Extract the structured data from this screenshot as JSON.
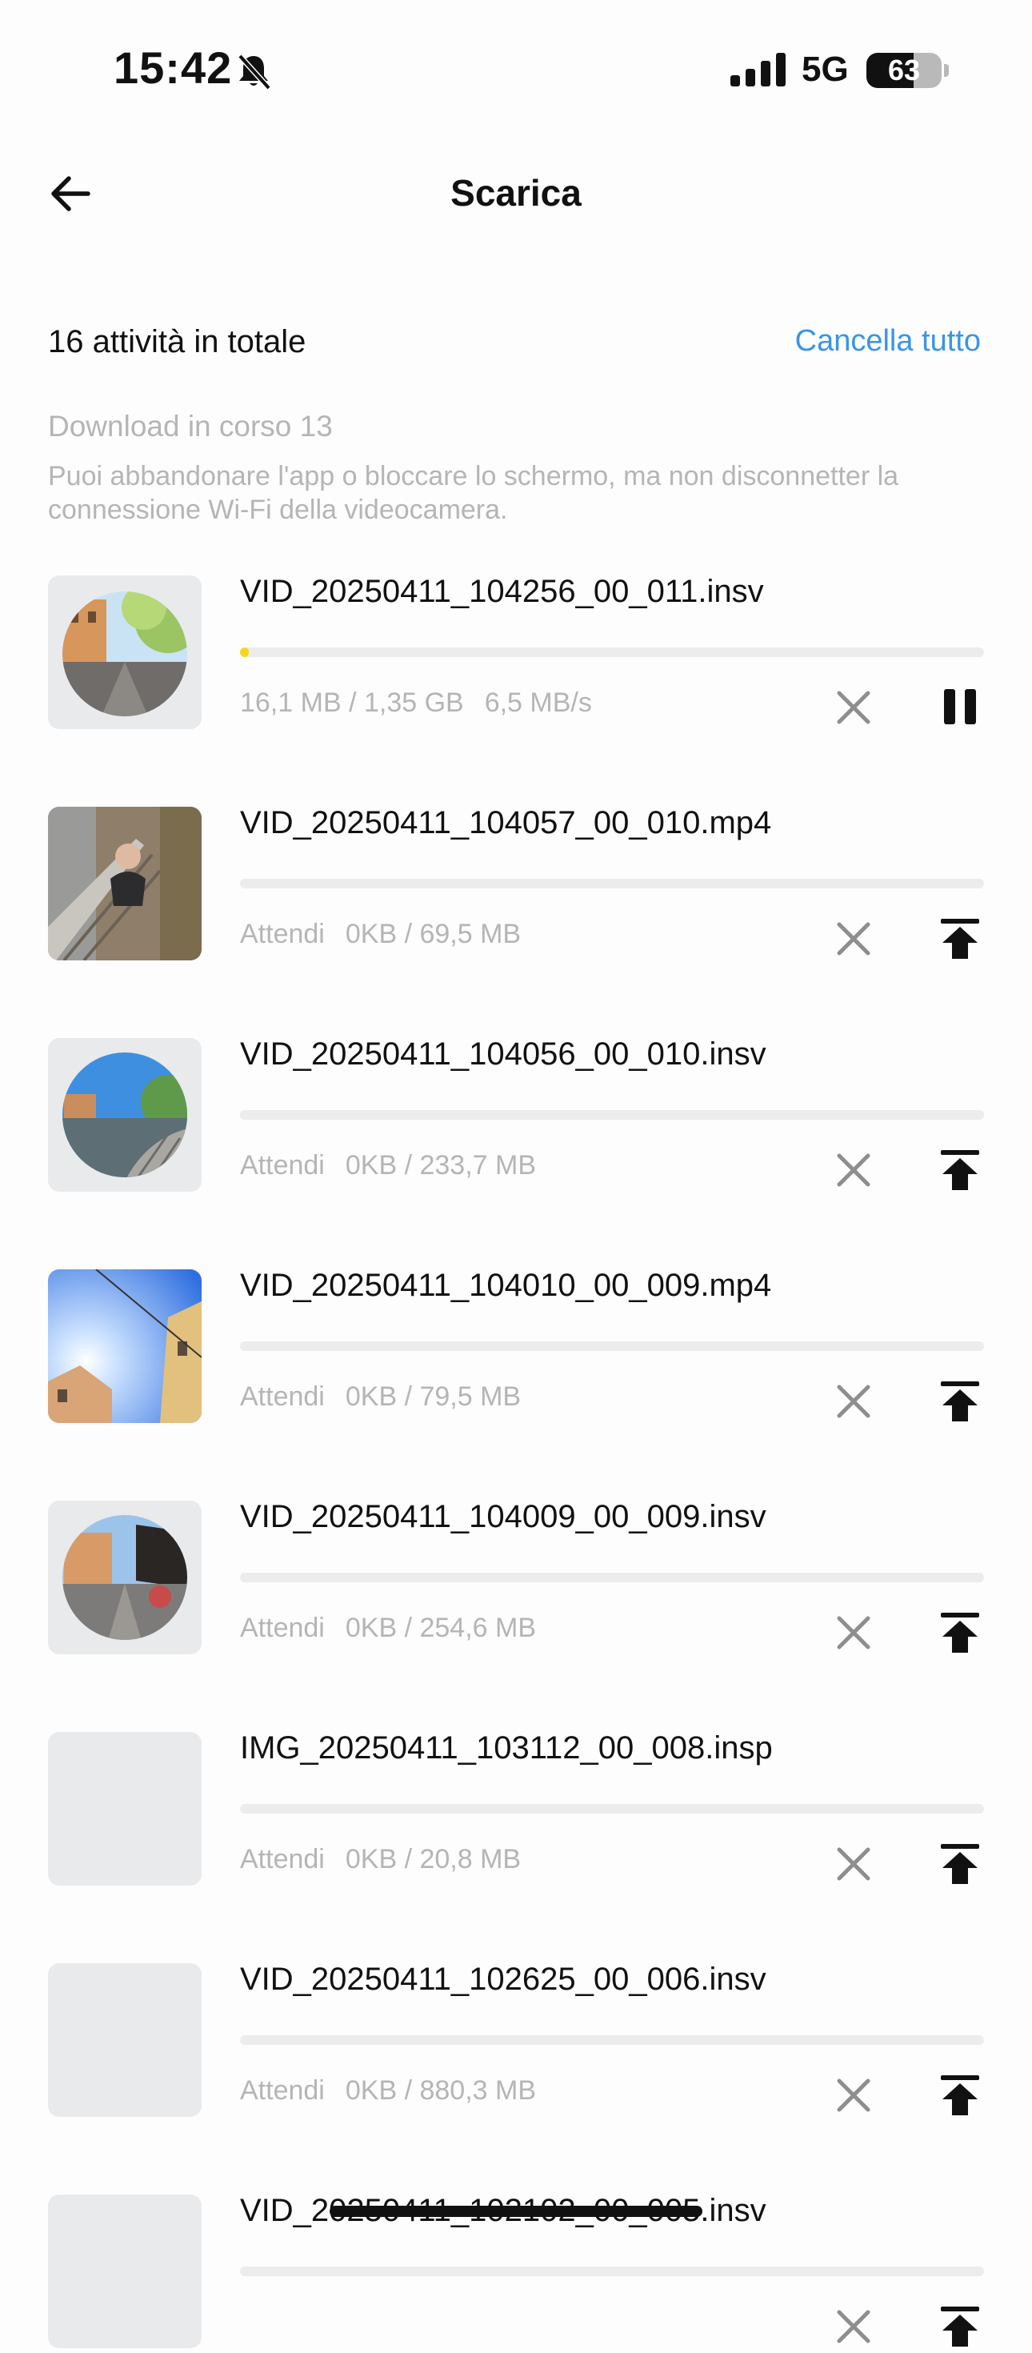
{
  "status_bar": {
    "time": "15:42",
    "network": "5G",
    "battery": "63",
    "battery_level": 0.63
  },
  "header": {
    "title": "Scarica"
  },
  "summary": {
    "total": "16 attività in totale",
    "clear_all": "Cancella tutto"
  },
  "section": {
    "title": "Download in corso 13",
    "notice": "Puoi abbandonare l'app o bloccare lo schermo, ma non disconnetter la connessione Wi-Fi della videocamera."
  },
  "icons": {
    "back": "arrow-left-icon",
    "mute": "bell-slash-icon",
    "cancel": "close-icon",
    "pause": "pause-icon",
    "priority": "move-to-top-icon"
  },
  "colors": {
    "accent": "#3a95e4",
    "progress": "#f6d61a",
    "muted_text": "#b5b5b5"
  },
  "items": [
    {
      "name": "VID_20250411_104256_00_011.insv",
      "status": "",
      "size": "16,1 MB / 1,35 GB",
      "speed": "6,5 MB/s",
      "progress": 0.012,
      "action": "pause",
      "thumb": "round-street"
    },
    {
      "name": "VID_20250411_104057_00_010.mp4",
      "status": "Attendi",
      "size": "0KB / 69,5 MB",
      "speed": "",
      "progress": 0,
      "action": "priority",
      "thumb": "flat-selfie"
    },
    {
      "name": "VID_20250411_104056_00_010.insv",
      "status": "Attendi",
      "size": "0KB / 233,7 MB",
      "speed": "",
      "progress": 0,
      "action": "priority",
      "thumb": "round-canal"
    },
    {
      "name": "VID_20250411_104010_00_009.mp4",
      "status": "Attendi",
      "size": "0KB / 79,5 MB",
      "speed": "",
      "progress": 0,
      "action": "priority",
      "thumb": "flat-sky"
    },
    {
      "name": "VID_20250411_104009_00_009.insv",
      "status": "Attendi",
      "size": "0KB / 254,6 MB",
      "speed": "",
      "progress": 0,
      "action": "priority",
      "thumb": "round-plaza"
    },
    {
      "name": "IMG_20250411_103112_00_008.insp",
      "status": "Attendi",
      "size": "0KB / 20,8 MB",
      "speed": "",
      "progress": 0,
      "action": "priority",
      "thumb": "empty"
    },
    {
      "name": "VID_20250411_102625_00_006.insv",
      "status": "Attendi",
      "size": "0KB / 880,3 MB",
      "speed": "",
      "progress": 0,
      "action": "priority",
      "thumb": "empty"
    },
    {
      "name": "VID_20250411_102102_00_005.insv",
      "status": "",
      "size": "",
      "speed": "",
      "progress": 0,
      "action": "priority",
      "thumb": "empty"
    }
  ]
}
